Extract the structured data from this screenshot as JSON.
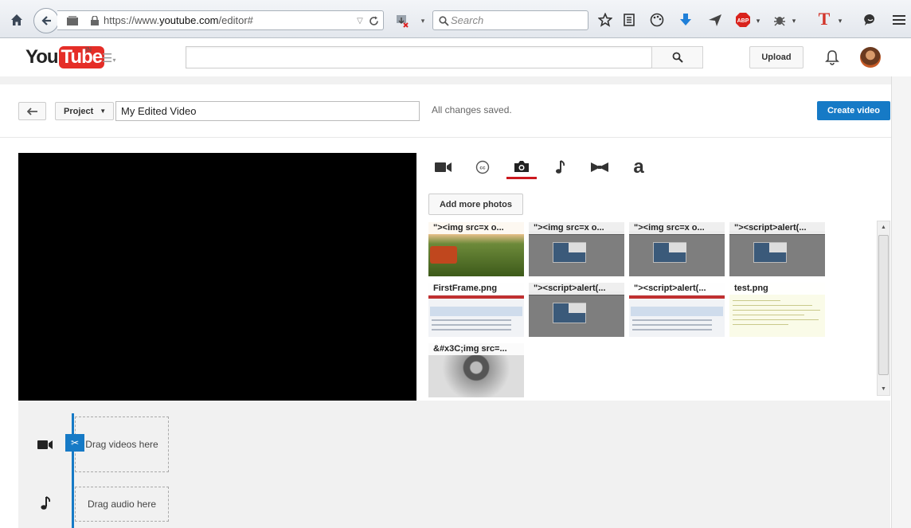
{
  "browser": {
    "url_prefix": "https://www.",
    "url_domain": "youtube.com",
    "url_path": "/editor#",
    "search_placeholder": "Search"
  },
  "header": {
    "logo_you": "You",
    "logo_tube": "Tube",
    "logo_region": "IN",
    "upload_label": "Upload"
  },
  "editor": {
    "project_label": "Project",
    "title_value": "My Edited Video",
    "save_status": "All changes saved.",
    "create_label": "Create video",
    "add_photos_label": "Add more photos"
  },
  "tabs": [
    {
      "name": "videos",
      "icon": "video-camera-icon"
    },
    {
      "name": "captions",
      "icon": "cc-icon"
    },
    {
      "name": "photos",
      "icon": "camera-icon",
      "active": true
    },
    {
      "name": "audio",
      "icon": "music-note-icon"
    },
    {
      "name": "transitions",
      "icon": "bowtie-icon"
    },
    {
      "name": "titles",
      "icon": "text-a-icon"
    }
  ],
  "photos": [
    {
      "label": "\"><img src=x o...",
      "thumb": "field"
    },
    {
      "label": "\"><img src=x o...",
      "thumb": "screenshot"
    },
    {
      "label": "\"><img src=x o...",
      "thumb": "screenshot"
    },
    {
      "label": "\"><script>alert(...",
      "thumb": "screenshot"
    },
    {
      "label": "FirstFrame.png",
      "thumb": "webpage"
    },
    {
      "label": "\"><script>alert(...",
      "thumb": "screenshot"
    },
    {
      "label": "\"><script>alert(...",
      "thumb": "webpage"
    },
    {
      "label": "test.png",
      "thumb": "textdoc"
    },
    {
      "label": "&#x3C;img src=...",
      "thumb": "sculpture"
    }
  ],
  "timeline": {
    "video_drop": "Drag videos here",
    "audio_drop": "Drag audio here"
  },
  "colors": {
    "accent": "#167ac6",
    "tab_active": "#cc181e",
    "logo_red": "#e52d27"
  }
}
